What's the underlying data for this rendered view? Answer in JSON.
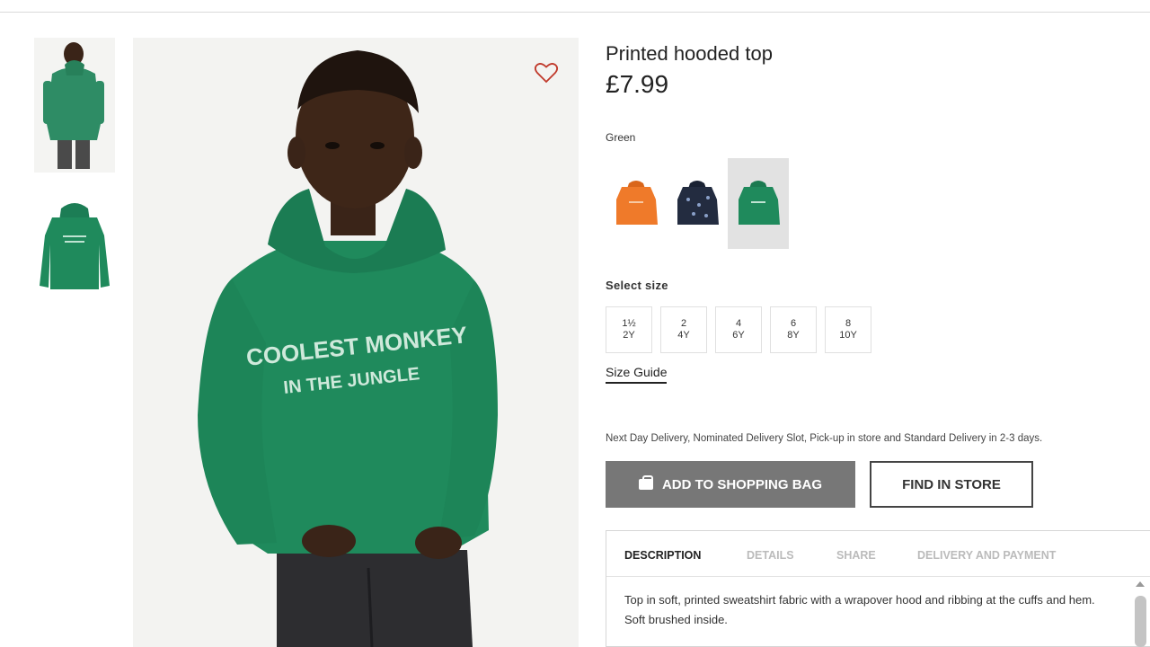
{
  "product": {
    "title": "Printed hooded top",
    "price": "£7.99",
    "image_print": [
      "COOLEST MONKEY",
      "IN THE JUNGLE"
    ]
  },
  "color": {
    "selected_label": "Green",
    "swatches": [
      {
        "name": "orange",
        "hex": "#ef7a2a"
      },
      {
        "name": "navy",
        "hex": "#232c40"
      },
      {
        "name": "green",
        "hex": "#1f8a5c",
        "selected": true
      }
    ]
  },
  "size": {
    "label": "Select size",
    "options": [
      {
        "line1": "1½",
        "line2": "2Y"
      },
      {
        "line1": "2",
        "line2": "4Y"
      },
      {
        "line1": "4",
        "line2": "6Y"
      },
      {
        "line1": "6",
        "line2": "8Y"
      },
      {
        "line1": "8",
        "line2": "10Y"
      }
    ],
    "guide_label": "Size Guide"
  },
  "delivery_text": "Next Day Delivery, Nominated Delivery Slot, Pick-up in store and Standard Delivery in 2-3 days.",
  "actions": {
    "add_to_bag": "ADD TO SHOPPING BAG",
    "find_in_store": "FIND IN STORE"
  },
  "info_tabs": [
    {
      "label": "DESCRIPTION",
      "active": true
    },
    {
      "label": "DETAILS"
    },
    {
      "label": "SHARE"
    },
    {
      "label": "DELIVERY AND PAYMENT"
    }
  ],
  "description": "Top in soft, printed sweatshirt fabric with a wrapover hood and ribbing at the cuffs and hem. Soft brushed inside.",
  "icons": {
    "wishlist": "heart-icon",
    "bag": "shopping-bag-icon"
  },
  "colors": {
    "hoodie_green": "#1f8a5c",
    "button_grey": "#777777",
    "wishlist_red": "#c0392b"
  }
}
